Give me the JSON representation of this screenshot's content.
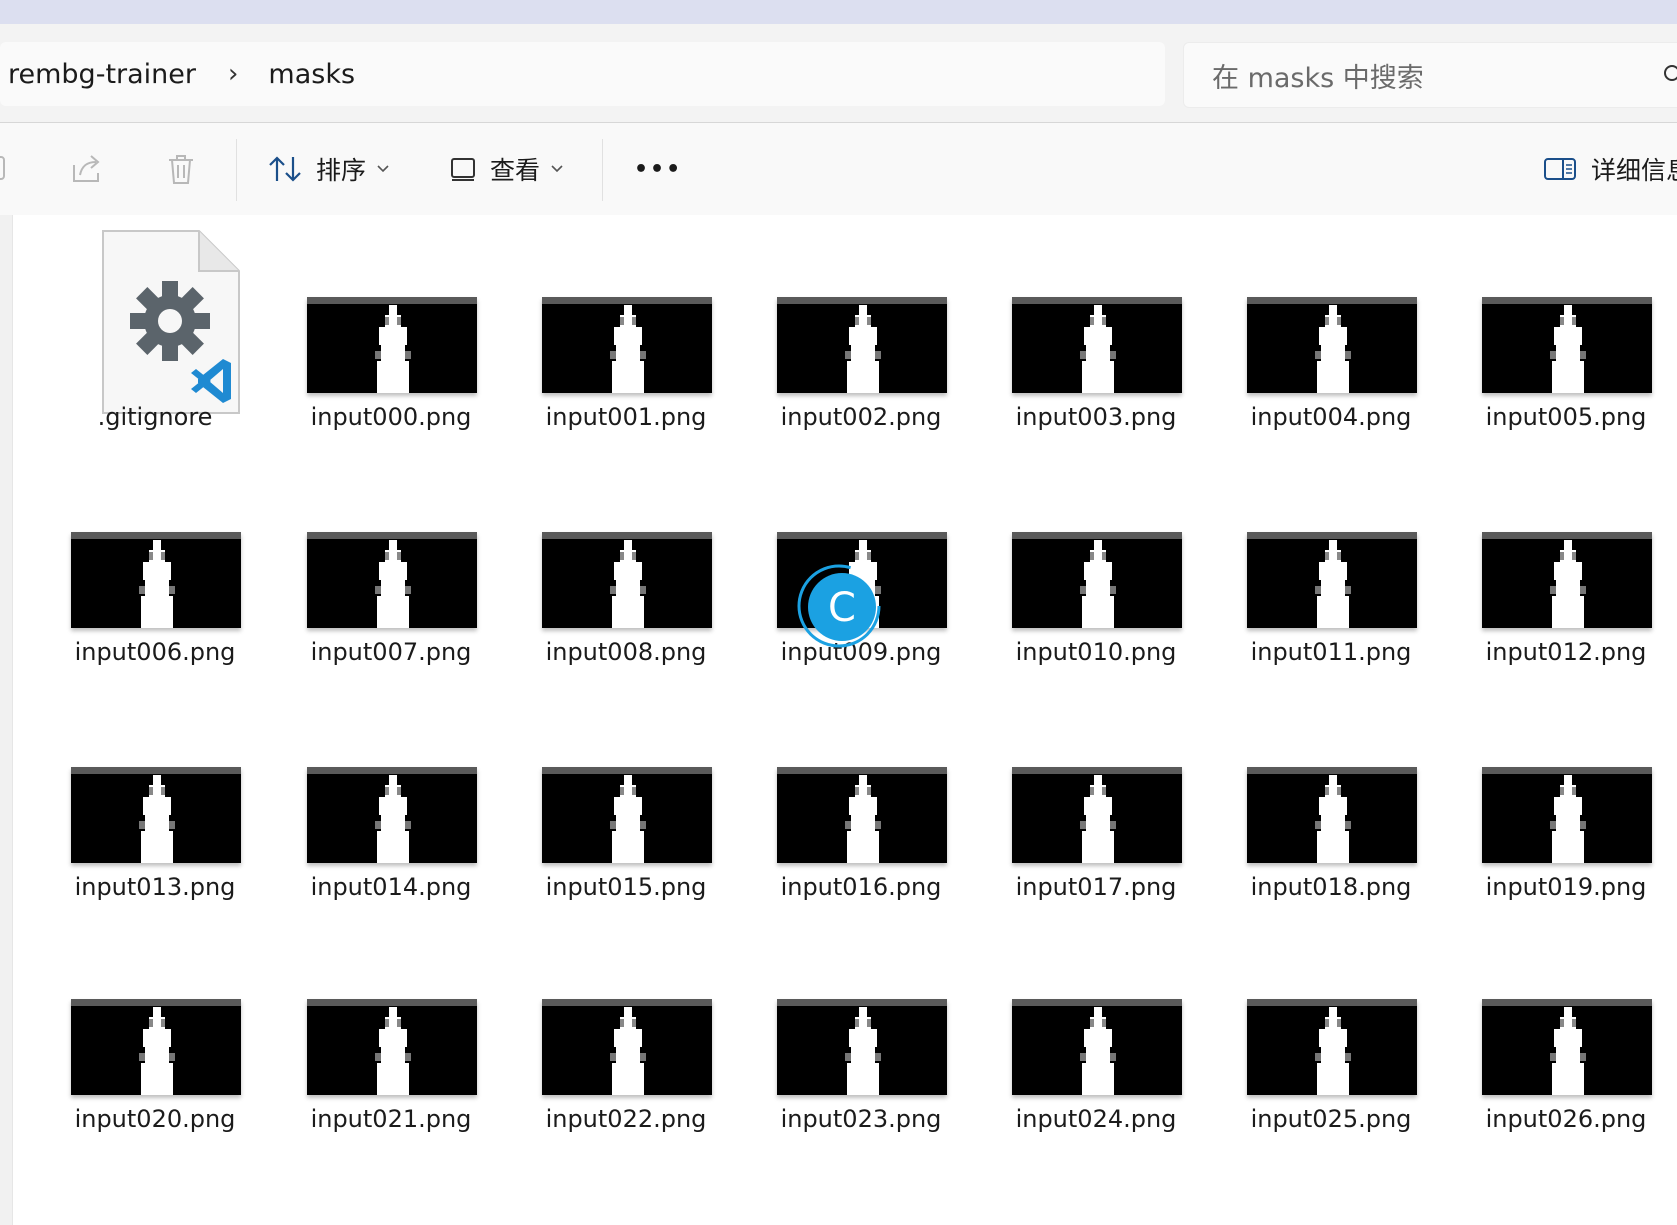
{
  "breadcrumb": {
    "items": [
      "rembg-trainer",
      "masks"
    ]
  },
  "search": {
    "placeholder": "在 masks 中搜索"
  },
  "toolbar": {
    "sort_label": "排序",
    "view_label": "查看",
    "more_label": "•••",
    "details_label": "详细信息"
  },
  "files": [
    {
      "name": ".gitignore",
      "type": "config"
    },
    {
      "name": "input000.png",
      "type": "image"
    },
    {
      "name": "input001.png",
      "type": "image"
    },
    {
      "name": "input002.png",
      "type": "image"
    },
    {
      "name": "input003.png",
      "type": "image"
    },
    {
      "name": "input004.png",
      "type": "image"
    },
    {
      "name": "input005.png",
      "type": "image"
    },
    {
      "name": "input006.png",
      "type": "image"
    },
    {
      "name": "input007.png",
      "type": "image"
    },
    {
      "name": "input008.png",
      "type": "image"
    },
    {
      "name": "input009.png",
      "type": "image"
    },
    {
      "name": "input010.png",
      "type": "image"
    },
    {
      "name": "input011.png",
      "type": "image"
    },
    {
      "name": "input012.png",
      "type": "image"
    },
    {
      "name": "input013.png",
      "type": "image"
    },
    {
      "name": "input014.png",
      "type": "image"
    },
    {
      "name": "input015.png",
      "type": "image"
    },
    {
      "name": "input016.png",
      "type": "image"
    },
    {
      "name": "input017.png",
      "type": "image"
    },
    {
      "name": "input018.png",
      "type": "image"
    },
    {
      "name": "input019.png",
      "type": "image"
    },
    {
      "name": "input020.png",
      "type": "image"
    },
    {
      "name": "input021.png",
      "type": "image"
    },
    {
      "name": "input022.png",
      "type": "image"
    },
    {
      "name": "input023.png",
      "type": "image"
    },
    {
      "name": "input024.png",
      "type": "image"
    },
    {
      "name": "input025.png",
      "type": "image"
    },
    {
      "name": "input026.png",
      "type": "image"
    }
  ],
  "overlay": {
    "spinner_letter": "C",
    "spinner_color": "#1ba1e2"
  },
  "icons": {
    "gitignore": "vscode-config-file-icon",
    "share": "share-icon",
    "delete": "trash-icon",
    "sort": "sort-arrows-icon",
    "view": "view-square-icon",
    "details": "details-pane-icon",
    "search": "search-icon"
  }
}
